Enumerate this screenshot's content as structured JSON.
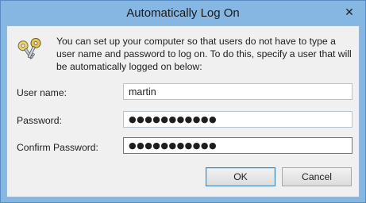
{
  "window": {
    "title": "Automatically Log On",
    "close_glyph": "✕"
  },
  "intro_text": "You can set up your computer so that users do not have to type a user name and password to log on. To do this, specify a user that will be automatically logged on below:",
  "icon": "keys-icon",
  "fields": {
    "username": {
      "label": "User name:",
      "value": "martin"
    },
    "password": {
      "label": "Password:",
      "value": "●●●●●●●●●●●"
    },
    "confirm": {
      "label": "Confirm Password:",
      "value": "●●●●●●●●●●●"
    }
  },
  "buttons": {
    "ok": "OK",
    "cancel": "Cancel"
  },
  "colors": {
    "frame": "#86b6e2",
    "client": "#f0f0f0",
    "focus_border": "#3c82c8"
  }
}
